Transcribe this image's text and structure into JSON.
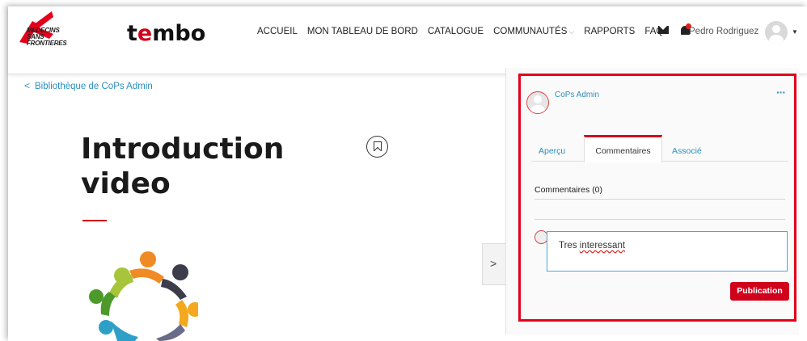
{
  "header": {
    "brand_msf": "MEDECINS SANS FRONTIERES",
    "brand_tembo_pre": "t",
    "brand_tembo_red": "e",
    "brand_tembo_post": "mbo",
    "nav": [
      "ACCUEIL",
      "MON TABLEAU DE BORD",
      "CATALOGUE",
      "COMMUNAUTÉS",
      "RAPPORTS",
      "FAQ"
    ],
    "user_name": "Pedro Rodriguez"
  },
  "content": {
    "breadcrumb": "Bibliothèque de CoPs Admin",
    "title_line1": "Introduction",
    "title_line2": "video"
  },
  "panel": {
    "author": "CoPs Admin",
    "more": "···",
    "tabs": [
      "Aperçu",
      "Commentaires",
      "Associé"
    ],
    "active_tab": "Commentaires",
    "comments_heading": "Commentaires (0)",
    "comment_text_pre": "Tres ",
    "comment_text_typo": "interessant",
    "publish_label": "Publication"
  },
  "colors": {
    "accent_red": "#d0021b",
    "link_blue": "#2a8fbf",
    "highlight": "#e3001b"
  }
}
